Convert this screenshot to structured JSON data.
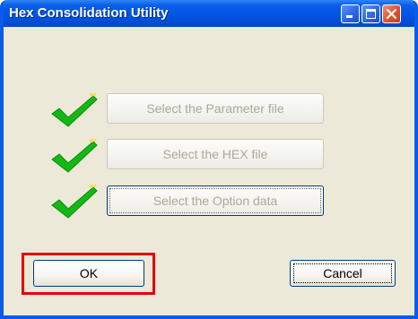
{
  "window": {
    "title": "Hex Consolidation Utility"
  },
  "buttons": {
    "parameter_file": "Select the Parameter file",
    "hex_file": "Select the HEX file",
    "option_data": "Select the Option data",
    "ok": "OK",
    "cancel": "Cancel"
  },
  "icons": {
    "check": "green-checkmark-icon"
  },
  "colors": {
    "titlebar": "#0054E3",
    "window_bg": "#ECE9D8",
    "check_green": "#14B814",
    "highlight": "#E3000B",
    "disabled_text": "#ABA899"
  }
}
